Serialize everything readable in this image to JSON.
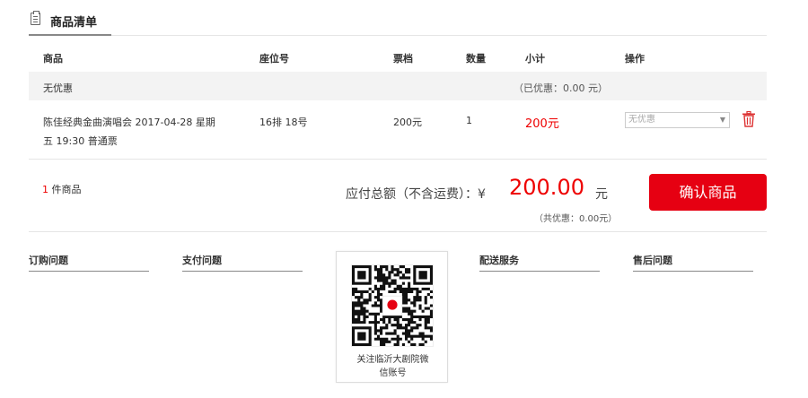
{
  "section": {
    "title": "商品清单",
    "icon": "list-icon"
  },
  "table": {
    "headers": [
      "商品",
      "座位号",
      "票档",
      "数量",
      "小计",
      "操作"
    ],
    "promo_row": {
      "label": "无优惠",
      "note": "（已优惠：0.00 元）"
    },
    "item": {
      "name_line1": "陈佳经典金曲演唱会 2017-04-28 星期",
      "name_line2": "五 19:30 普通票",
      "seat": "16排 18号",
      "tier": "200元",
      "qty": "1",
      "subtotal": "200元",
      "promo_select": "无优惠",
      "delete_icon": "trash-icon"
    }
  },
  "summary": {
    "count_num": "1",
    "count_text": " 件商品",
    "total_label": "应付总额（不含运费）：¥",
    "total_amount": "200.00",
    "total_unit": "元",
    "total_save": "（共优惠：0.00元）",
    "confirm_label": "确认商品"
  },
  "footer": {
    "columns": [
      "订购问题",
      "支付问题",
      "配送服务",
      "售后问题"
    ],
    "qr_caption_line1": "关注临沂大剧院微",
    "qr_caption_line2": "信账号"
  },
  "colors": {
    "accent": "#e60012",
    "price": "#ee0000",
    "row_bg": "#f3f3f3"
  }
}
